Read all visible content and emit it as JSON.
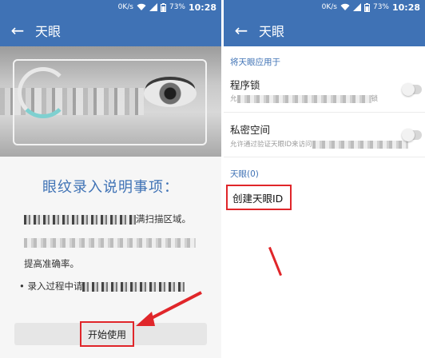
{
  "status_bar": {
    "speed": "0K/s",
    "battery": "73%",
    "time": "10:28"
  },
  "left": {
    "title": "天眼",
    "intro_title": "眼纹录入说明事项：",
    "line1_suffix": "满扫描区域。",
    "line3": "提高准确率。",
    "line4_prefix": "• 录入过程中请",
    "start_button": "开始使用"
  },
  "right": {
    "title": "天眼",
    "section_apply": "将天眼应用于",
    "item1_title": "程序锁",
    "item1_sub_prefix": "允",
    "item1_sub_suffix": "锁",
    "item2_title": "私密空间",
    "item2_sub": "允许通过验证天眼ID来访问",
    "section_eyes": "天眼(0)",
    "create_id": "创建天眼ID"
  },
  "colors": {
    "primary": "#3f72b5",
    "highlight": "#e0262a"
  },
  "icons": [
    "back-arrow-icon",
    "wifi-icon",
    "signal-icon",
    "battery-icon"
  ]
}
